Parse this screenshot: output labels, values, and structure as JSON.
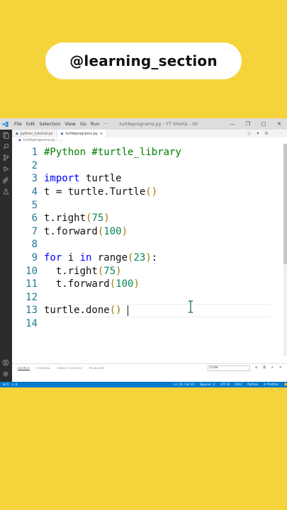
{
  "overlay": {
    "handle": "@learning_section"
  },
  "window": {
    "menu": [
      "File",
      "Edit",
      "Selection",
      "View",
      "Go",
      "Run",
      "···"
    ],
    "title": "turtleprograms.py - YT Shorts - Visu...",
    "controls": [
      "—",
      "❐",
      "□",
      "✕"
    ]
  },
  "tabs": [
    {
      "label": "python_tutorial.py",
      "active": false
    },
    {
      "label": "turtleprograms.py",
      "active": true,
      "close": "×"
    }
  ],
  "tab_actions": "▷ ▾ ⊟ ···",
  "breadcrumb": "turtleprograms.py  ›  ...",
  "code_lines": [
    {
      "num": "1",
      "segments": [
        {
          "t": "#Python #turtle_library",
          "cls": "c"
        }
      ]
    },
    {
      "num": "2",
      "segments": []
    },
    {
      "num": "3",
      "segments": [
        {
          "t": "import",
          "cls": "k"
        },
        {
          "t": " turtle",
          "cls": ""
        }
      ]
    },
    {
      "num": "4",
      "segments": [
        {
          "t": "t = turtle.Turtle",
          "cls": ""
        },
        {
          "t": "()",
          "cls": "p"
        }
      ]
    },
    {
      "num": "5",
      "segments": []
    },
    {
      "num": "6",
      "segments": [
        {
          "t": "t.right",
          "cls": ""
        },
        {
          "t": "(",
          "cls": "p"
        },
        {
          "t": "75",
          "cls": "n"
        },
        {
          "t": ")",
          "cls": "p"
        }
      ]
    },
    {
      "num": "7",
      "segments": [
        {
          "t": "t.forward",
          "cls": ""
        },
        {
          "t": "(",
          "cls": "p"
        },
        {
          "t": "100",
          "cls": "n"
        },
        {
          "t": ")",
          "cls": "p"
        }
      ]
    },
    {
      "num": "8",
      "segments": []
    },
    {
      "num": "9",
      "segments": [
        {
          "t": "for",
          "cls": "k"
        },
        {
          "t": " i ",
          "cls": ""
        },
        {
          "t": "in",
          "cls": "k"
        },
        {
          "t": " range",
          "cls": ""
        },
        {
          "t": "(",
          "cls": "p"
        },
        {
          "t": "23",
          "cls": "n"
        },
        {
          "t": ")",
          "cls": "p"
        },
        {
          "t": ":",
          "cls": ""
        }
      ]
    },
    {
      "num": "10",
      "segments": [
        {
          "t": "  t.right",
          "cls": ""
        },
        {
          "t": "(",
          "cls": "p"
        },
        {
          "t": "75",
          "cls": "n"
        },
        {
          "t": ")",
          "cls": "p"
        }
      ]
    },
    {
      "num": "11",
      "segments": [
        {
          "t": "  t.forward",
          "cls": ""
        },
        {
          "t": "(",
          "cls": "p"
        },
        {
          "t": "100",
          "cls": "n"
        },
        {
          "t": ")",
          "cls": "p"
        }
      ]
    },
    {
      "num": "12",
      "segments": []
    },
    {
      "num": "13",
      "segments": [
        {
          "t": "turtle.done",
          "cls": ""
        },
        {
          "t": "()",
          "cls": "p"
        }
      ],
      "current": true
    },
    {
      "num": "14",
      "segments": []
    }
  ],
  "panel": {
    "tabs": [
      "OUTPUT",
      "TERMINAL",
      "DEBUG CONSOLE",
      "PROBLEMS"
    ],
    "active_tab": "OUTPUT",
    "select_value": "Code",
    "actions": "≡ ⧉ ∧ ✕"
  },
  "statusbar": {
    "left": [
      "⊗ 0",
      "⚠ 0"
    ],
    "right": [
      "Ln 13, Col 15",
      "Spaces: 2",
      "UTF-8",
      "CRLF",
      "Python",
      "⊙ Prettier",
      "🔔"
    ]
  },
  "colors": {
    "background": "#f5d33a",
    "statusbar": "#007acc",
    "keyword": "#0000ff",
    "comment": "#008000",
    "number": "#098658",
    "bracket": "#a07a00",
    "line_number": "#237893"
  }
}
